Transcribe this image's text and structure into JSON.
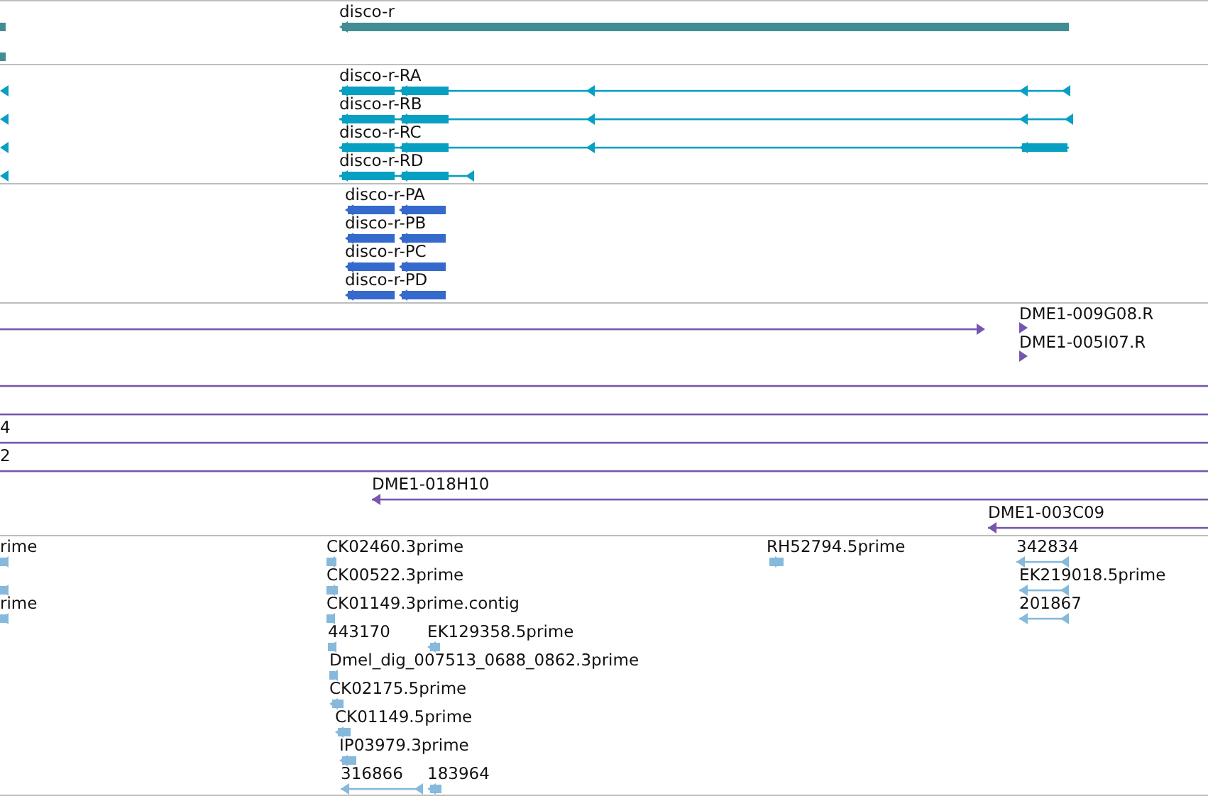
{
  "tracks": [
    {
      "kind": "gene",
      "features": [
        {
          "label": "disco-r",
          "reverse": true
        }
      ]
    },
    {
      "kind": "transcript",
      "features": [
        {
          "label": "disco-r-RA",
          "reverse": true
        },
        {
          "label": "disco-r-RB",
          "reverse": true
        },
        {
          "label": "disco-r-RC",
          "reverse": true
        },
        {
          "label": "disco-r-RD",
          "reverse": true
        },
        {
          "reverse": true
        },
        {
          "reverse": true
        },
        {
          "reverse": true
        },
        {
          "reverse": true
        }
      ]
    },
    {
      "kind": "protein",
      "features": [
        {
          "label": "disco-r-PA",
          "reverse": true
        },
        {
          "label": "disco-r-PB",
          "reverse": true
        },
        {
          "label": "disco-r-PC",
          "reverse": true
        },
        {
          "label": "disco-r-PD",
          "reverse": true
        }
      ]
    },
    {
      "kind": "clone",
      "features": [
        {
          "reverse": false
        },
        {
          "label": "DME1-009G08.R",
          "reverse": false
        },
        {
          "label": "DME1-005I07.R",
          "reverse": false
        },
        {
          "label": "4"
        },
        {
          "label": "2"
        },
        {
          "label": "DME1-018H10",
          "reverse": true
        },
        {
          "label": "DME1-003C09",
          "reverse": true
        }
      ]
    },
    {
      "kind": "est",
      "features": [
        {
          "label": "rime",
          "reverse": true
        },
        {
          "label": "CK02460.3prime",
          "reverse": true
        },
        {
          "label": "RH52794.5prime",
          "reverse": false
        },
        {
          "label": "342834",
          "reverse": true
        },
        {
          "reverse": true
        },
        {
          "label": "CK00522.3prime",
          "reverse": true
        },
        {
          "label": "EK219018.5prime",
          "reverse": true
        },
        {
          "label": "rime",
          "reverse": true
        },
        {
          "label": "CK01149.3prime.contig",
          "reverse": true
        },
        {
          "label": "201867",
          "reverse": true
        },
        {
          "label": "443170",
          "reverse": true
        },
        {
          "label": "EK129358.5prime",
          "reverse": true
        },
        {
          "label": "Dmel_dig_007513_0688_0862.3prime",
          "reverse": true
        },
        {
          "label": "CK02175.5prime",
          "reverse": true
        },
        {
          "label": "CK01149.5prime",
          "reverse": true
        },
        {
          "label": "IP03979.3prime",
          "reverse": true
        },
        {
          "label": "316866",
          "reverse": true
        },
        {
          "label": "183964",
          "reverse": true
        }
      ]
    }
  ]
}
